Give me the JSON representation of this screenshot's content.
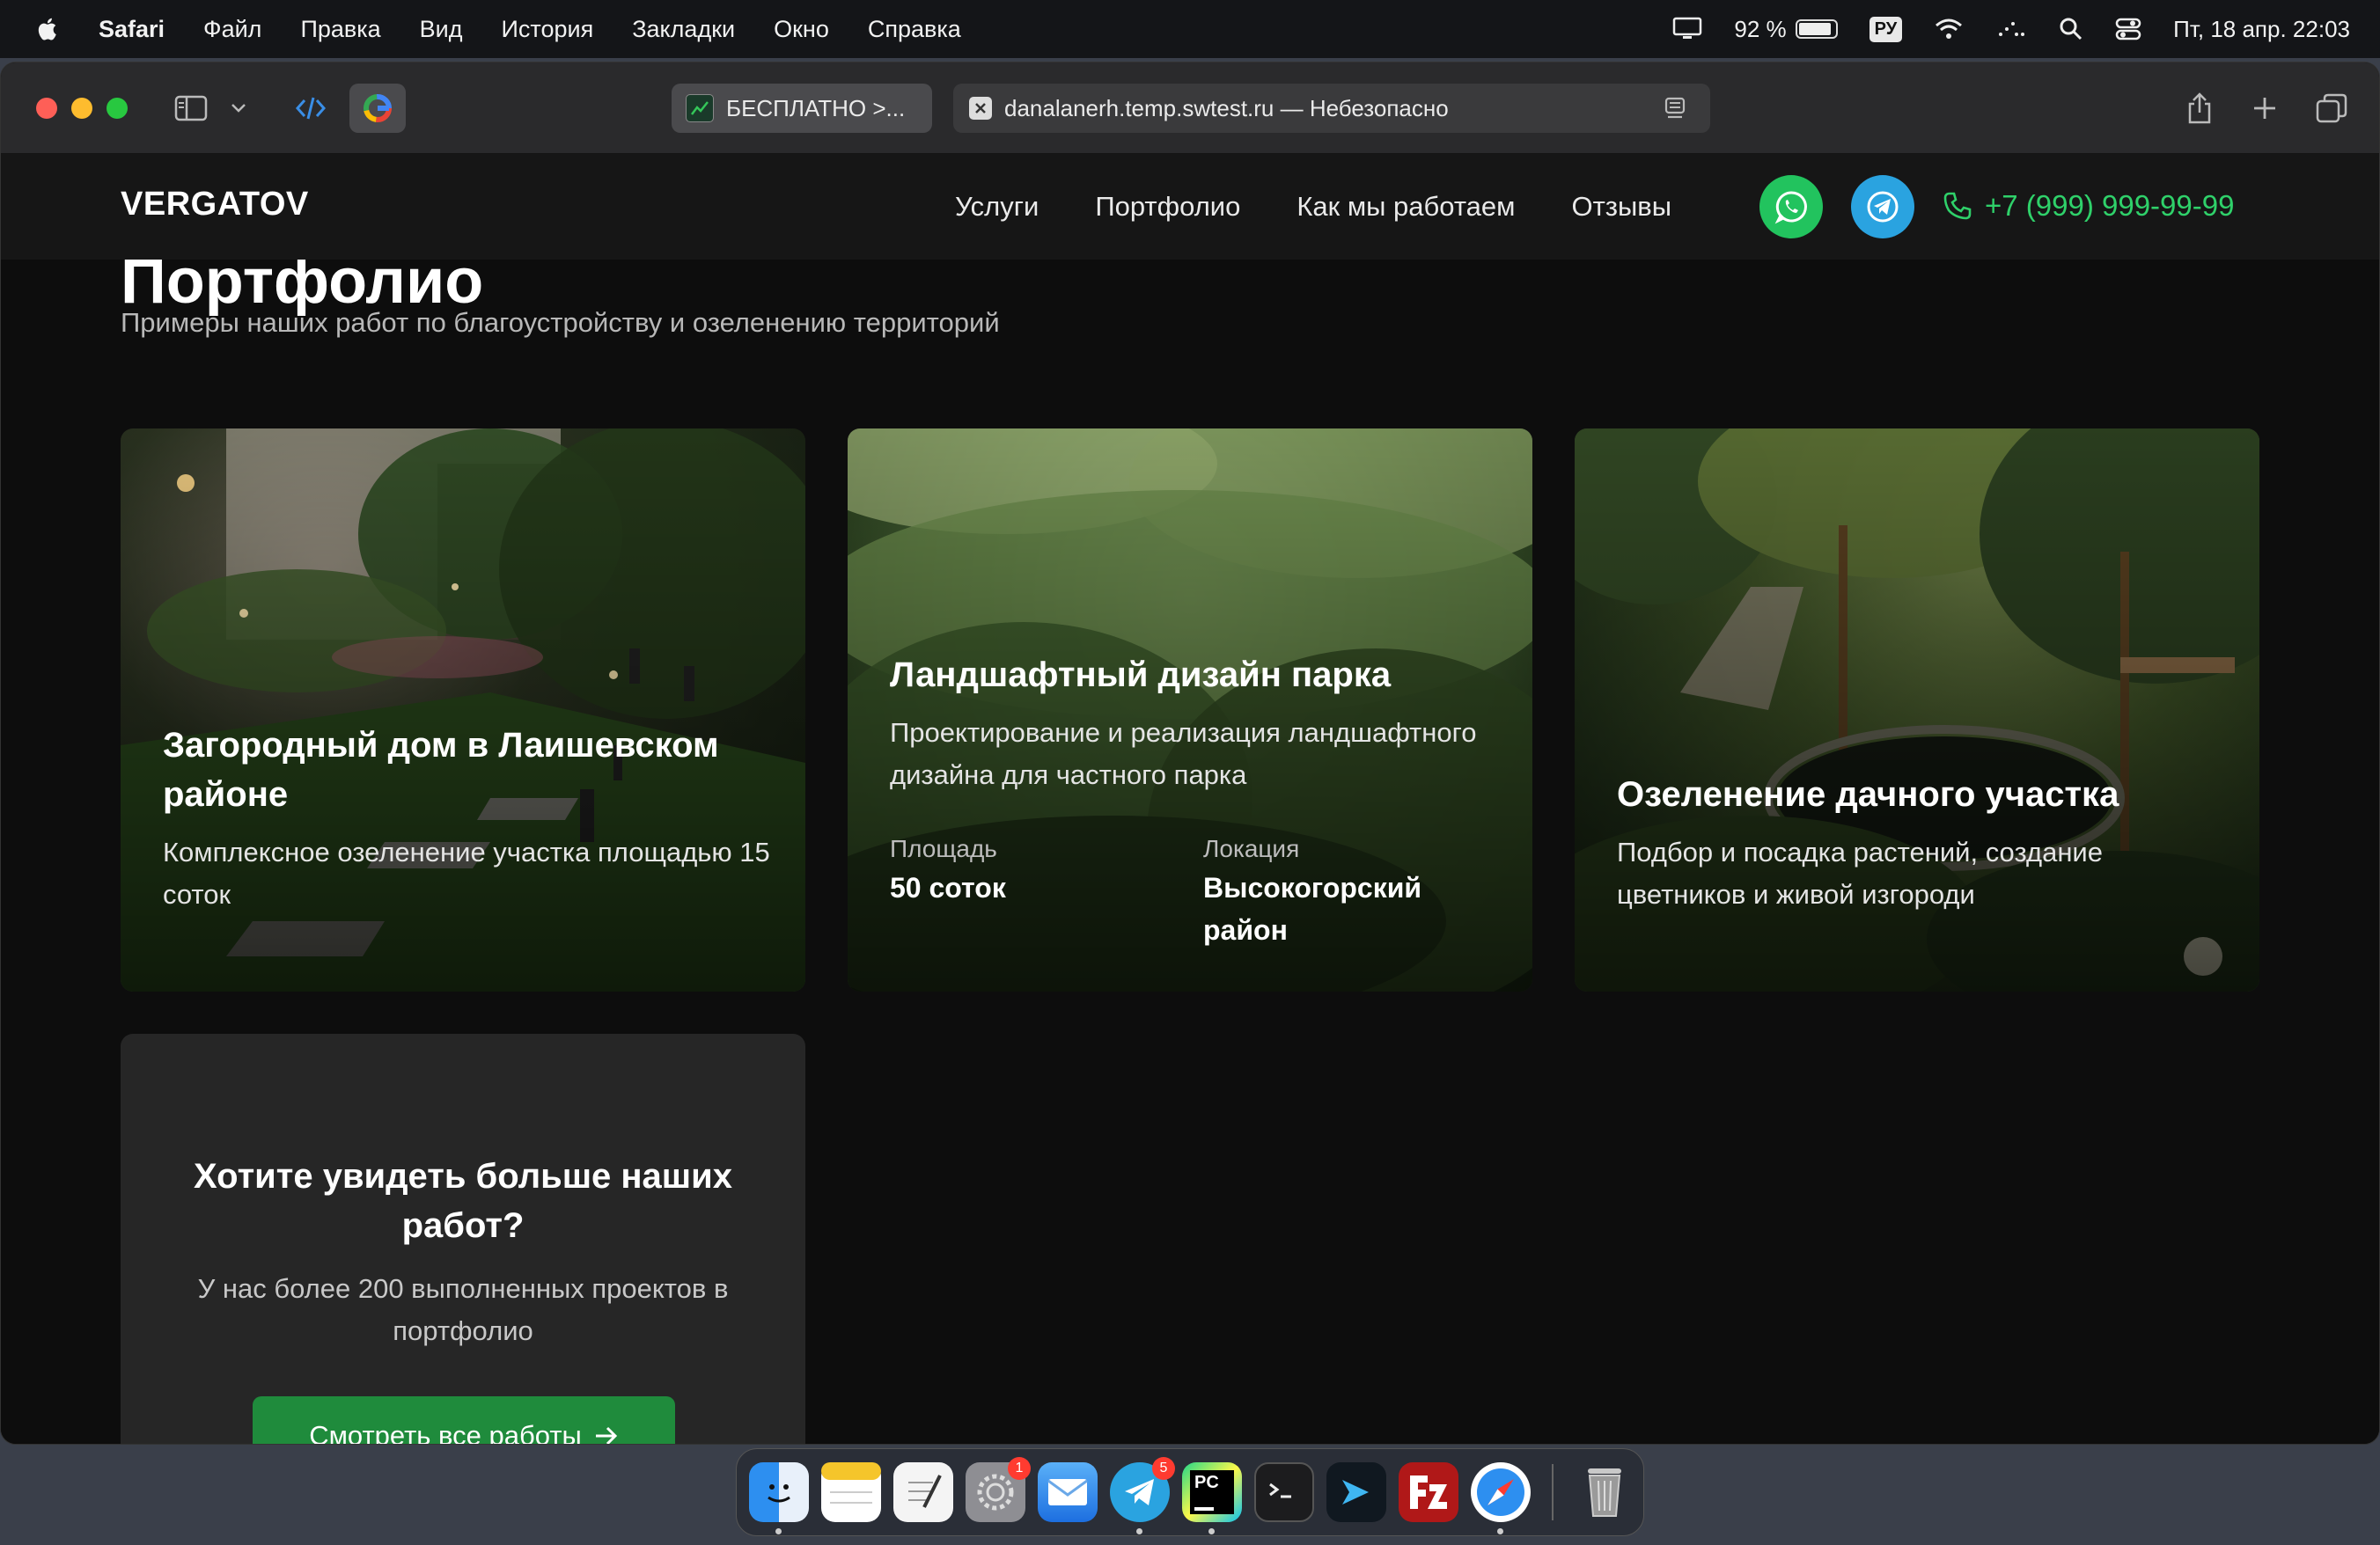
{
  "menubar": {
    "app_name": "Safari",
    "items": [
      "Файл",
      "Правка",
      "Вид",
      "История",
      "Закладки",
      "Окно",
      "Справка"
    ],
    "battery": "92 %",
    "keyboard_layout": "РУ",
    "datetime": "Пт, 18 апр.  22:03"
  },
  "browser": {
    "tab_inactive": "БЕСПЛАТНО >...",
    "tab_active": "danalanerh.temp.swtest.ru — Небезопасно"
  },
  "site": {
    "logo": "VERGATOV",
    "nav": [
      "Услуги",
      "Портфолио",
      "Как мы работаем",
      "Отзывы"
    ],
    "phone": "+7 (999) 999-99-99",
    "section_title": "Портфолио",
    "section_subtitle": "Примеры наших работ по благоустройству и озеленению территорий",
    "cards": [
      {
        "title": "Загородный дом в Лаишевском районе",
        "desc": "Комплексное озеленение участка площадью 15 соток"
      },
      {
        "title": "Ландшафтный дизайн парка",
        "desc": "Проектирование и реализация ландшафтного дизайна для частного парка",
        "meta": [
          {
            "label": "Площадь",
            "value": "50 соток"
          },
          {
            "label": "Локация",
            "value": "Высокогорский район"
          }
        ]
      },
      {
        "title": "Озеленение дачного участка",
        "desc": "Подбор и посадка растений, создание цветников и живой изгороди"
      }
    ],
    "cta": {
      "title": "Хотите увидеть больше наших работ?",
      "text": "У нас более 200 выполненных проектов в портфолио",
      "button": "Смотреть все работы"
    }
  },
  "dock": {
    "badges": {
      "settings": "1",
      "telegram": "5"
    },
    "pycharm_label": "PC"
  },
  "colors": {
    "accent_green": "#2fd16a",
    "whatsapp": "#22c35e",
    "telegram": "#2aa3e0",
    "button_green": "#1f8b3c"
  }
}
